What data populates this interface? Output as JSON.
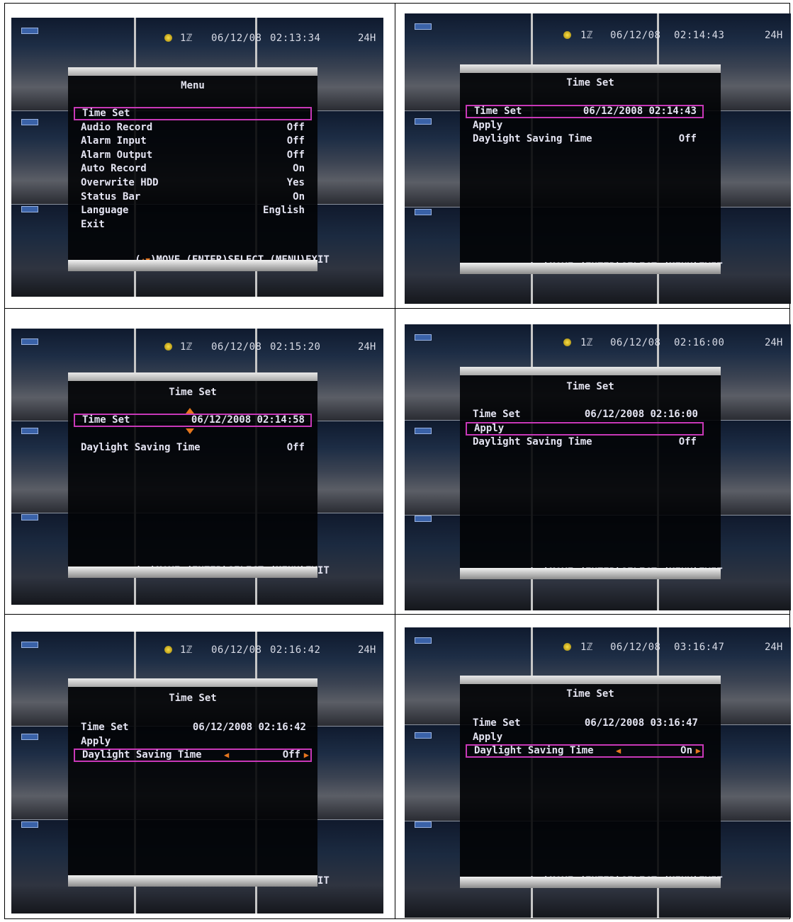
{
  "colors": {
    "highlight": "#c838b8",
    "arrow": "#e5761e",
    "text": "#e4e4f2"
  },
  "help_parts": [
    "(",
    "▲▼",
    ")MOVE (ENTER)SELECT (MENU)EXIT"
  ],
  "panels": [
    {
      "status": {
        "channel": "1ℤ",
        "date": "06/12/08",
        "time": "02:13:34",
        "hours": "24H"
      },
      "title": "Menu",
      "rows": [
        {
          "label": "Time Set",
          "value": "",
          "selected": true
        },
        {
          "label": "Audio Record",
          "value": "Off"
        },
        {
          "label": "Alarm Input",
          "value": "Off"
        },
        {
          "label": "Alarm Output",
          "value": "Off"
        },
        {
          "label": "Auto Record",
          "value": "On"
        },
        {
          "label": "Overwrite HDD",
          "value": "Yes"
        },
        {
          "label": "Status Bar",
          "value": "On"
        },
        {
          "label": "Language",
          "value": "English"
        },
        {
          "label": "Exit",
          "value": ""
        }
      ]
    },
    {
      "status": {
        "channel": "1ℤ",
        "date": "06/12/08",
        "time": "02:14:43",
        "hours": "24H"
      },
      "title": "Time Set",
      "rows": [
        {
          "label": "Time Set",
          "value": "06/12/2008 02:14:43",
          "selected": true
        },
        {
          "label": "Apply",
          "value": ""
        },
        {
          "label": "Daylight Saving Time",
          "value": "Off"
        }
      ]
    },
    {
      "status": {
        "channel": "1ℤ",
        "date": "06/12/08",
        "time": "02:15:20",
        "hours": "24H"
      },
      "title": "Time Set",
      "rows": [
        {
          "label": "Time Set",
          "value": "06/12/2008 02:14:58",
          "selected": true,
          "updown": true
        },
        {
          "label": "",
          "value": ""
        },
        {
          "label": "Daylight Saving Time",
          "value": "Off"
        }
      ]
    },
    {
      "status": {
        "channel": "1ℤ",
        "date": "06/12/08",
        "time": "02:16:00",
        "hours": "24H"
      },
      "title": "Time Set",
      "rows": [
        {
          "label": "Time Set",
          "value": "06/12/2008 02:16:00"
        },
        {
          "label": "Apply",
          "value": "",
          "selected": true
        },
        {
          "label": "Daylight Saving Time",
          "value": "Off"
        }
      ]
    },
    {
      "status": {
        "channel": "1ℤ",
        "date": "06/12/08",
        "time": "02:16:42",
        "hours": "24H"
      },
      "title": "Time Set",
      "rows": [
        {
          "label": "Time Set",
          "value": "06/12/2008 02:16:42"
        },
        {
          "label": "Apply",
          "value": ""
        },
        {
          "label": "Daylight Saving Time",
          "value": "Off",
          "selected": true,
          "leftright": true
        }
      ]
    },
    {
      "status": {
        "channel": "1ℤ",
        "date": "06/12/08",
        "time": "03:16:47",
        "hours": "24H"
      },
      "title": "Time Set",
      "rows": [
        {
          "label": "Time Set",
          "value": "06/12/2008 03:16:47"
        },
        {
          "label": "Apply",
          "value": ""
        },
        {
          "label": "Daylight Saving Time",
          "value": "On",
          "selected": true,
          "leftright": true
        }
      ]
    }
  ]
}
